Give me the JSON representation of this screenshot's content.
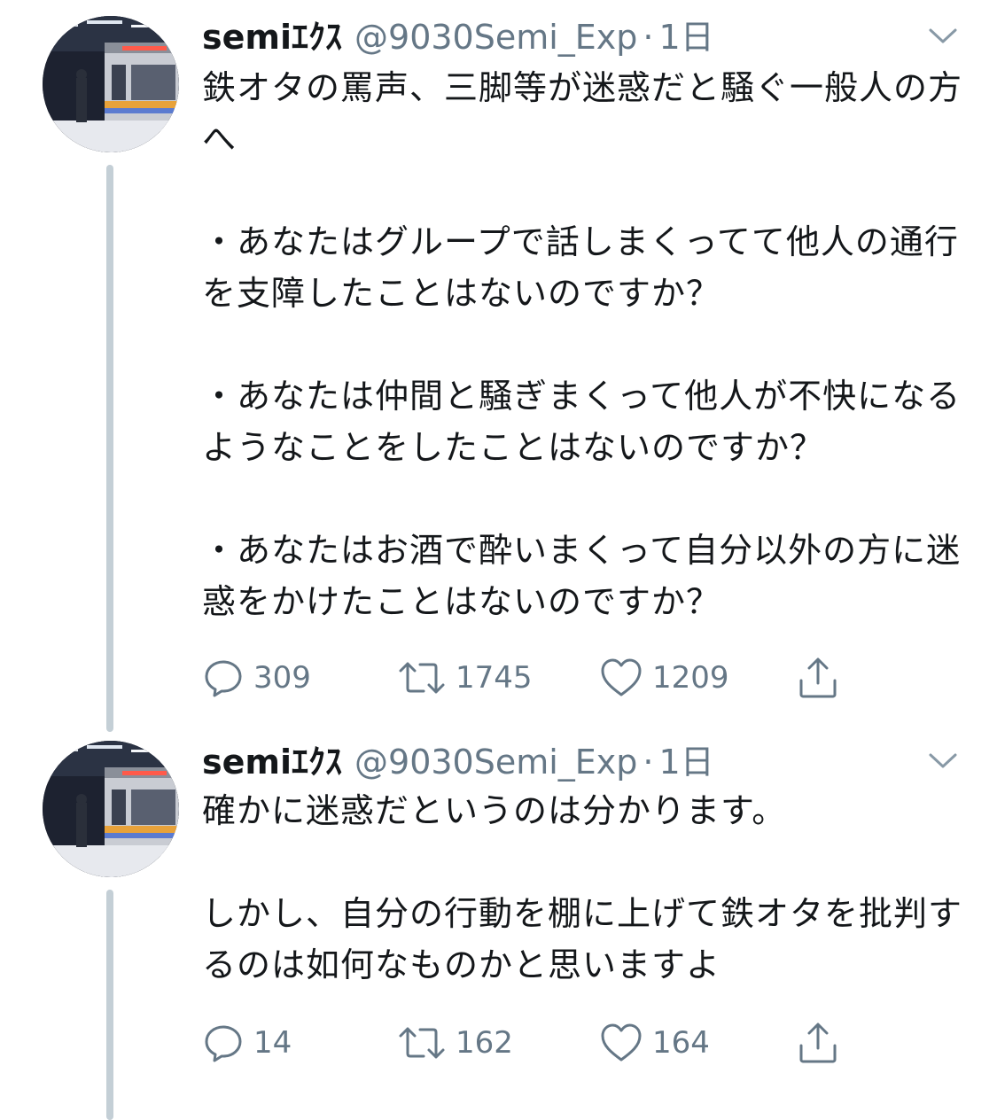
{
  "tweets": [
    {
      "name": "semiｴｸｽ",
      "handle": "@9030Semi_Exp",
      "separator": "·",
      "time": "1日",
      "paragraphs": [
        "鉄オタの罵声、三脚等が迷惑だと騒ぐ一般人の方へ",
        "・あなたはグループで話しまくってて他人の通行を支障したことはないのですか？",
        "・あなたは仲間と騒ぎまくって他人が不快になるようなことをしたことはないのですか？",
        "・あなたはお酒で酔いまくって自分以外の方に迷惑をかけたことはないのですか？"
      ],
      "replies": "309",
      "retweets": "1745",
      "likes": "1209"
    },
    {
      "name": "semiｴｸｽ",
      "handle": "@9030Semi_Exp",
      "separator": "·",
      "time": "1日",
      "paragraphs": [
        "確かに迷惑だというのは分かります。",
        "しかし、自分の行動を棚に上げて鉄オタを批判するのは如何なものかと思いますよ"
      ],
      "replies": "14",
      "retweets": "162",
      "likes": "164"
    }
  ],
  "icons": {
    "reply": "reply-icon",
    "retweet": "retweet-icon",
    "like": "heart-icon",
    "share": "share-icon",
    "more": "chevron-down-icon"
  },
  "colors": {
    "text": "#14171a",
    "secondary": "#657786",
    "thread_line": "#c4cfd6"
  }
}
